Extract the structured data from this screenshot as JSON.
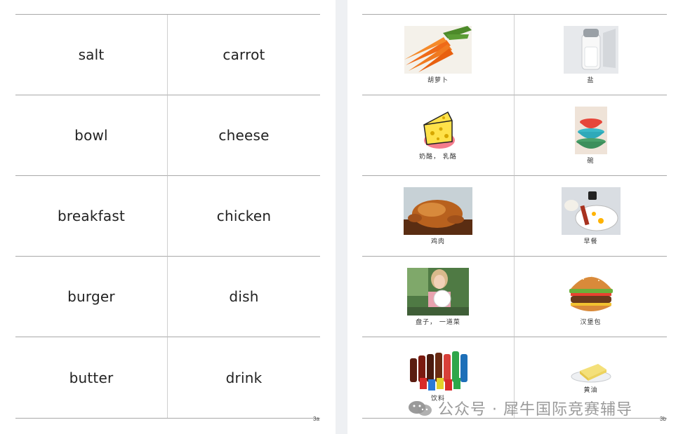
{
  "left_page": {
    "words": [
      [
        "salt",
        "carrot"
      ],
      [
        "bowl",
        "cheese"
      ],
      [
        "breakfast",
        "chicken"
      ],
      [
        "burger",
        "dish"
      ],
      [
        "butter",
        "drink"
      ]
    ],
    "page_number": "3a"
  },
  "right_page": {
    "captions": [
      [
        "胡萝卜",
        "盐"
      ],
      [
        "奶酪， 乳酪",
        "碗"
      ],
      [
        "鸡肉",
        "早餐"
      ],
      [
        "盘子， 一道菜",
        "汉堡包"
      ],
      [
        "饮料",
        "黄油"
      ]
    ],
    "page_number": "3b"
  },
  "watermark": {
    "text": "公众号 · 犀牛国际竞赛辅导"
  }
}
